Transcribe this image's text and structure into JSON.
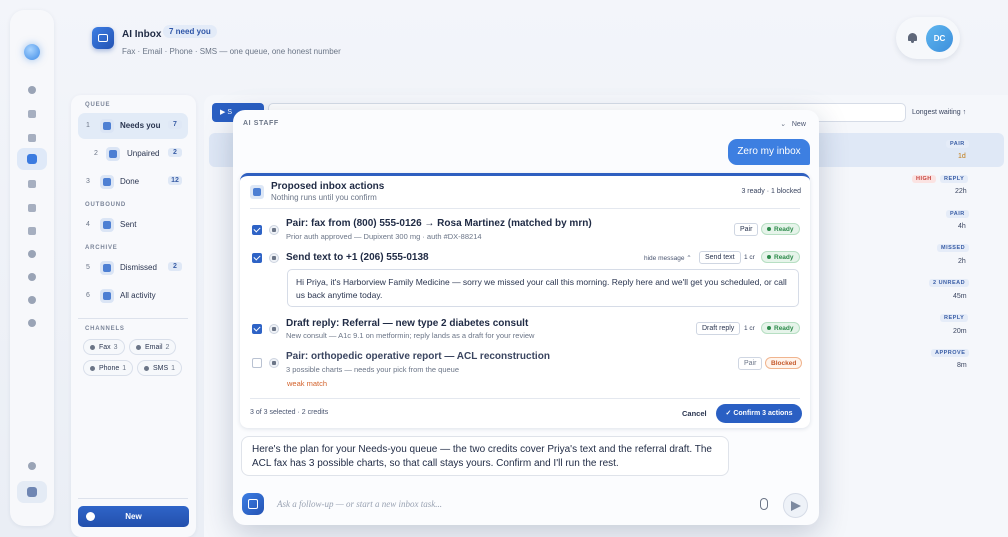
{
  "header": {
    "title": "AI Inbox",
    "badge": "7 need you",
    "subtitle": "Fax · Email · Phone · SMS — one queue, one honest number",
    "avatar": "DC"
  },
  "queue": {
    "section_queue": "QUEUE",
    "items": [
      {
        "num": "1",
        "label": "Needs you",
        "count": "7"
      },
      {
        "num": "2",
        "label": "Unpaired",
        "count": "2"
      },
      {
        "num": "3",
        "label": "Done",
        "count": "12"
      }
    ],
    "section_outbound": "OUTBOUND",
    "outbound": [
      {
        "num": "4",
        "label": "Sent"
      }
    ],
    "section_archive": "ARCHIVE",
    "archive": [
      {
        "num": "5",
        "label": "Dismissed",
        "count": "2"
      },
      {
        "num": "6",
        "label": "All activity"
      }
    ],
    "section_channels": "CHANNELS",
    "channels": [
      {
        "label": "Fax",
        "count": "3"
      },
      {
        "label": "Email",
        "count": "2"
      },
      {
        "label": "Phone",
        "count": "1"
      },
      {
        "label": "SMS",
        "count": "1"
      }
    ],
    "new_button": "New"
  },
  "list": {
    "send_button": "S",
    "sort_label": "Longest waiting ↑",
    "rows": [
      {
        "tag": "PAIR",
        "age": "1d",
        "high": ""
      },
      {
        "tag": "REPLY",
        "age": "22h",
        "high": "HIGH"
      },
      {
        "tag": "PAIR",
        "age": "4h",
        "high": ""
      },
      {
        "tag": "MISSED",
        "age": "2h",
        "high": ""
      },
      {
        "tag": "2 UNREAD",
        "age": "45m",
        "high": ""
      },
      {
        "tag": "REPLY",
        "age": "20m",
        "high": ""
      },
      {
        "tag": "APPROVE",
        "age": "8m",
        "high": ""
      }
    ]
  },
  "modal": {
    "heading": "AI STAFF",
    "new_label": "New",
    "user_message": "Zero my inbox",
    "card": {
      "title": "Proposed inbox actions",
      "subtitle": "Nothing runs until you confirm",
      "status": "3 ready · 1 blocked",
      "actions": [
        {
          "title": "Pair: fax from (800) 555-0126 → Rosa Martinez (matched by mrn)",
          "sub": "Prior auth approved — Dupixent 300 mg · auth #DX-88214",
          "button": "Pair",
          "status": "Ready"
        },
        {
          "title": "Send text to +1 (206) 555-0138",
          "hide": "hide message ⌃",
          "button": "Send text",
          "credits": "1 cr",
          "status": "Ready",
          "message": "Hi Priya, it's Harborview Family Medicine — sorry we missed your call this morning. Reply here and we'll get you scheduled, or call us back anytime today."
        },
        {
          "title": "Draft reply: Referral — new type 2 diabetes consult",
          "sub": "New consult — A1c 9.1 on metformin; reply lands as a draft for your review",
          "button": "Draft reply",
          "credits": "1 cr",
          "status": "Ready"
        },
        {
          "title": "Pair: orthopedic operative report — ACL reconstruction",
          "sub": "3 possible charts — needs your pick from the queue",
          "warn": "weak match",
          "button": "Pair",
          "status": "Blocked"
        }
      ],
      "footer": "3 of 3 selected · 2 credits",
      "cancel": "Cancel",
      "confirm": "✓ Confirm 3 actions"
    },
    "reply": "Here's the plan for your Needs-you queue — the two credits cover Priya's text and the referral draft. The ACL fax has 3 possible charts, so that call stays yours. Confirm and I'll run the rest.",
    "composer_placeholder": "Ask a follow-up — or start a new inbox task..."
  }
}
